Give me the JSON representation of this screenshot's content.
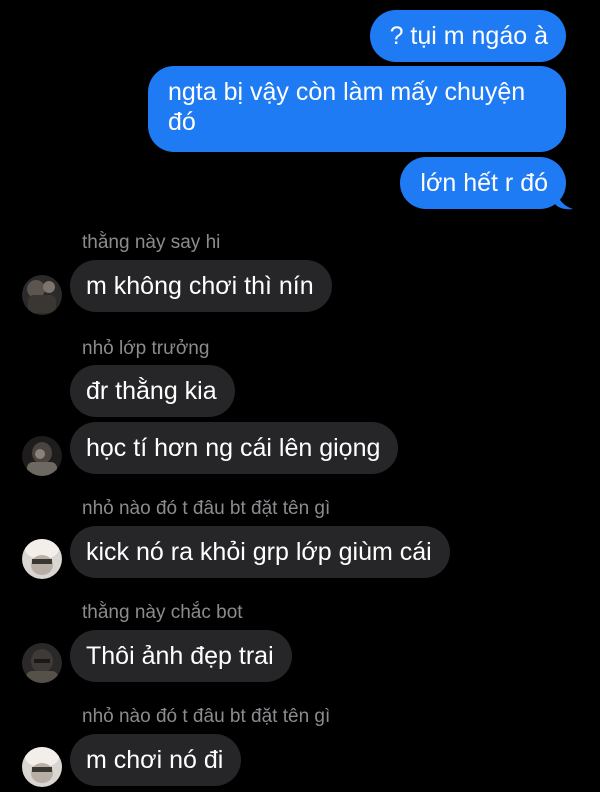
{
  "sent_messages": [
    {
      "text": "? tụi m ngáo à"
    },
    {
      "text_line1": "ngta bị vậy còn làm mấy chuyện",
      "text_line2": "đó"
    },
    {
      "text": "lớn hết r đó"
    }
  ],
  "received_groups": [
    {
      "sender": "thằng này say hi",
      "messages": [
        "m không chơi thì nín"
      ],
      "avatar": "avatar-photo-dark"
    },
    {
      "sender": "nhỏ lớp trưởng",
      "messages": [
        "đr thằng kia",
        "học tí hơn ng cái lên giọng"
      ],
      "avatar": "avatar-photo-dark"
    },
    {
      "sender": "nhỏ nào đó t đâu bt đặt tên gì",
      "messages": [
        "kick nó ra khỏi grp lớp giùm cái"
      ],
      "avatar": "avatar-photo-light"
    },
    {
      "sender": "thằng này chắc bot",
      "messages": [
        "Thôi ảnh đẹp trai"
      ],
      "avatar": "avatar-photo-dark"
    },
    {
      "sender": "nhỏ nào đó t đâu bt đặt tên gì",
      "messages": [
        "m chơi nó đi"
      ],
      "avatar": "avatar-photo-light"
    }
  ],
  "colors": {
    "background": "#000000",
    "sent_bubble": "#1f7bf4",
    "received_bubble": "#262628",
    "sender_name": "#8c8c90"
  }
}
